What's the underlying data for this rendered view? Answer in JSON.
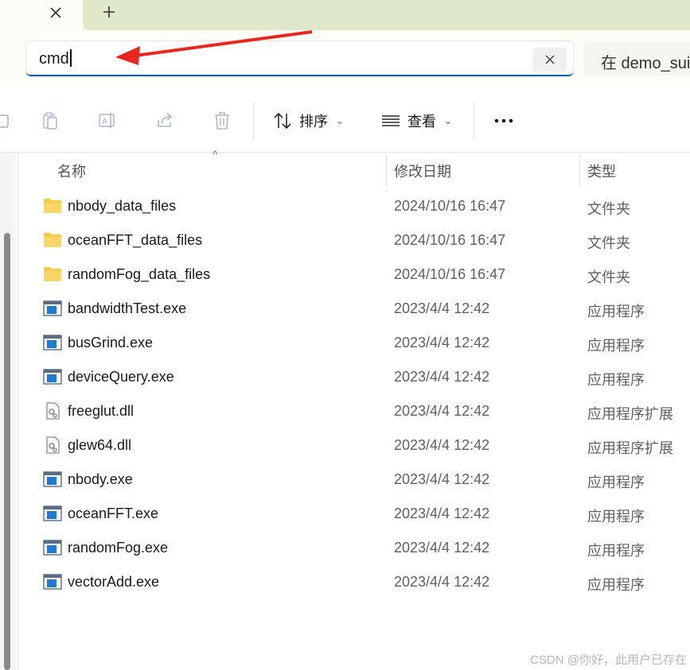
{
  "tabs": {
    "close_icon": "close-icon",
    "new_tab_icon": "plus-icon"
  },
  "address": {
    "value": "cmd",
    "clear_icon": "close-icon",
    "search_text": "在 demo_sui"
  },
  "toolbar": {
    "sort_label": "排序",
    "view_label": "查看",
    "more_label": "•••"
  },
  "columns": {
    "name": "名称",
    "date": "修改日期",
    "type": "类型"
  },
  "files": [
    {
      "name": "nbody_data_files",
      "date": "2024/10/16 16:47",
      "type": "文件夹",
      "icon": "folder"
    },
    {
      "name": "oceanFFT_data_files",
      "date": "2024/10/16 16:47",
      "type": "文件夹",
      "icon": "folder"
    },
    {
      "name": "randomFog_data_files",
      "date": "2024/10/16 16:47",
      "type": "文件夹",
      "icon": "folder"
    },
    {
      "name": "bandwidthTest.exe",
      "date": "2023/4/4 12:42",
      "type": "应用程序",
      "icon": "exe"
    },
    {
      "name": "busGrind.exe",
      "date": "2023/4/4 12:42",
      "type": "应用程序",
      "icon": "exe"
    },
    {
      "name": "deviceQuery.exe",
      "date": "2023/4/4 12:42",
      "type": "应用程序",
      "icon": "exe"
    },
    {
      "name": "freeglut.dll",
      "date": "2023/4/4 12:42",
      "type": "应用程序扩展",
      "icon": "dll"
    },
    {
      "name": "glew64.dll",
      "date": "2023/4/4 12:42",
      "type": "应用程序扩展",
      "icon": "dll"
    },
    {
      "name": "nbody.exe",
      "date": "2023/4/4 12:42",
      "type": "应用程序",
      "icon": "exe"
    },
    {
      "name": "oceanFFT.exe",
      "date": "2023/4/4 12:42",
      "type": "应用程序",
      "icon": "exe"
    },
    {
      "name": "randomFog.exe",
      "date": "2023/4/4 12:42",
      "type": "应用程序",
      "icon": "exe"
    },
    {
      "name": "vectorAdd.exe",
      "date": "2023/4/4 12:42",
      "type": "应用程序",
      "icon": "exe"
    }
  ],
  "watermark": "CSDN @你好，此用户已存在",
  "colors": {
    "accent": "#0b5cad",
    "arrow": "#e8271e",
    "folder": "#f8c945"
  }
}
